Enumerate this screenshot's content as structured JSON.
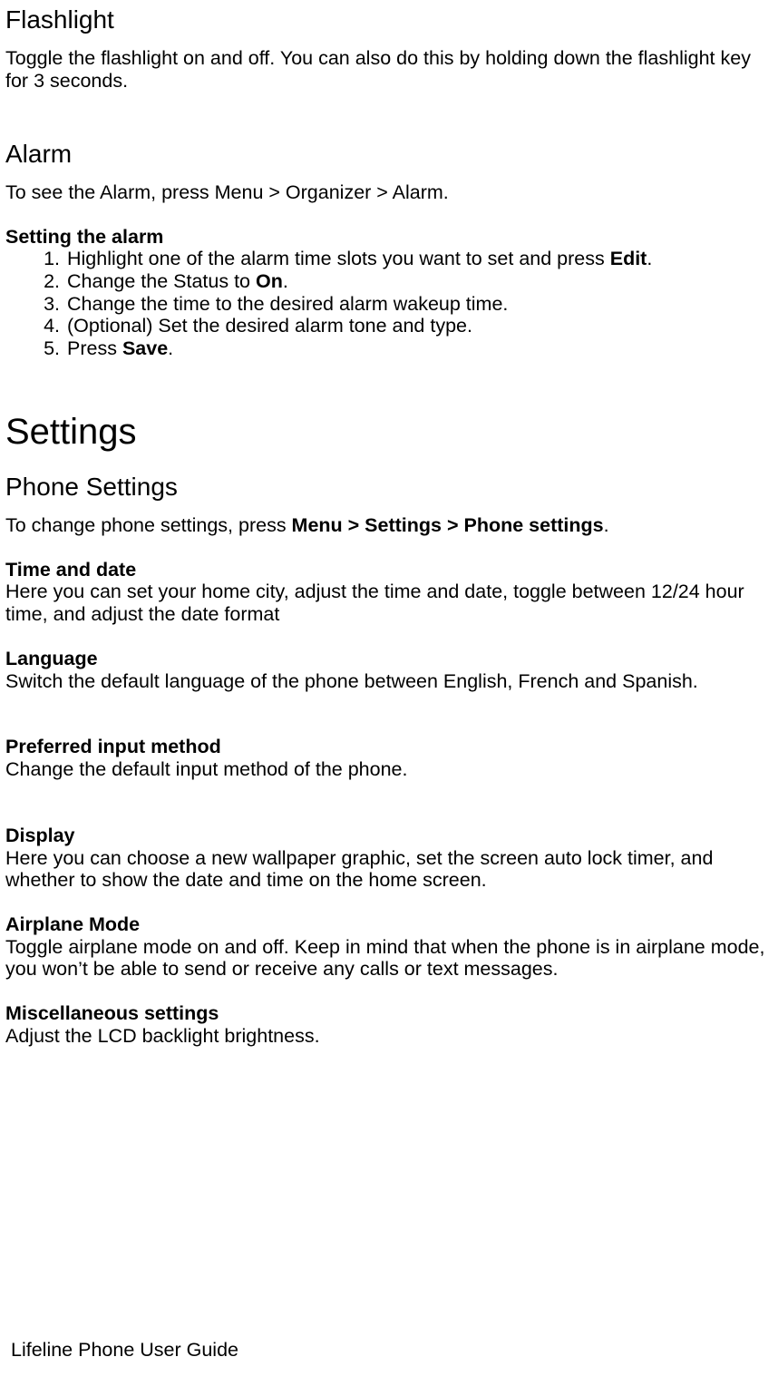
{
  "flashlight": {
    "heading": "Flashlight",
    "body": "Toggle the flashlight on and off. You can also do this by holding down the flashlight key for 3 seconds."
  },
  "alarm": {
    "heading": "Alarm",
    "intro": "To see the Alarm, press Menu > Organizer > Alarm.",
    "setting_heading": "Setting the alarm",
    "steps": {
      "s1a": "Highlight one of the alarm time slots you want to set and press ",
      "s1b": "Edit",
      "s1c": ".",
      "s2a": "Change the Status to ",
      "s2b": "On",
      "s2c": ".",
      "s3": "Change the time to the desired alarm wakeup time.",
      "s4": "(Optional) Set the desired alarm tone and type.",
      "s5a": "Press ",
      "s5b": "Save",
      "s5c": "."
    }
  },
  "settings": {
    "heading": "Settings",
    "phone_settings": {
      "heading": "Phone Settings",
      "intro_a": "To change phone settings, press ",
      "intro_b": "Menu > Settings > Phone settings",
      "intro_c": ".",
      "time_date": {
        "heading": "Time and date",
        "body": "Here you can set your home city, adjust the time and date, toggle between 12/24 hour time, and adjust the date format"
      },
      "language": {
        "heading": "Language",
        "body": "Switch the default language of the phone between English, French and Spanish."
      },
      "input_method": {
        "heading": "Preferred input method",
        "body": "Change the default input method of the phone."
      },
      "display": {
        "heading": "Display",
        "body": "Here you can choose a new wallpaper graphic, set the screen auto lock timer, and whether to show the date and time on the home screen."
      },
      "airplane": {
        "heading": "Airplane Mode",
        "body": "Toggle airplane mode on and off. Keep in mind that when the phone is in airplane mode, you won’t be able to send or receive any calls or text messages."
      },
      "misc": {
        "heading": "Miscellaneous settings",
        "body": "Adjust the LCD backlight brightness."
      }
    }
  },
  "footer": "Lifeline Phone User Guide"
}
